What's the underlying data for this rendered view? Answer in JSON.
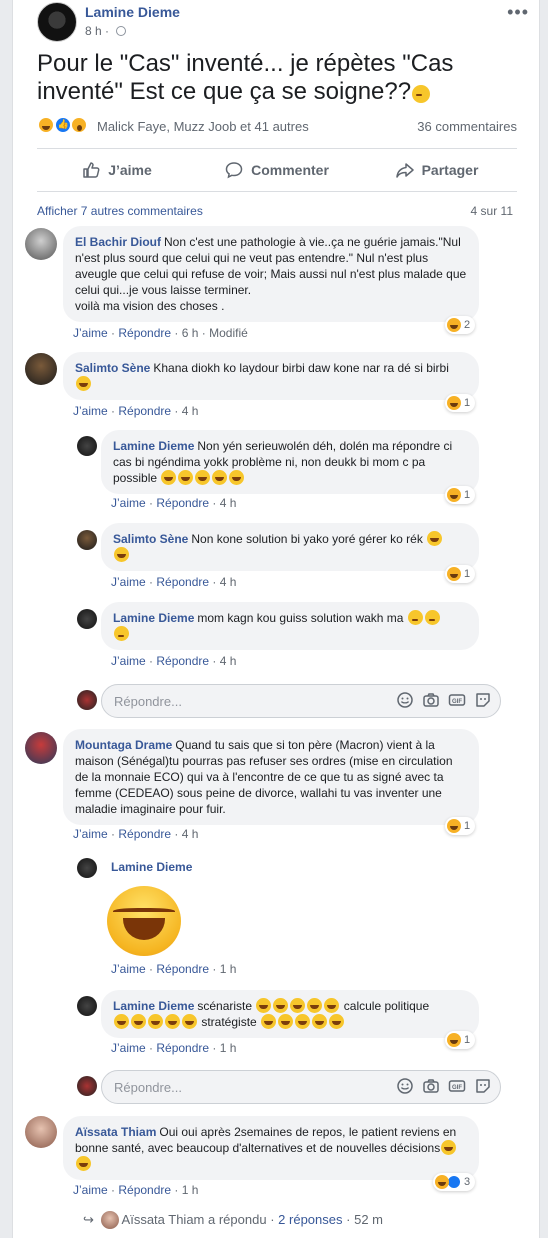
{
  "post": {
    "author": "Lamine Dieme",
    "time": "8 h",
    "text_part1": "Pour le \"Cas\" inventé... je répètes \"Cas inventé\" Est ce que ça se soigne??",
    "reactions_names": "Malick Faye, Muzz Joob et 41 autres",
    "comments_count": "36 commentaires",
    "actions": {
      "like": "J’aime",
      "comment": "Commenter",
      "share": "Partager"
    }
  },
  "comments_header": {
    "more": "Afficher 7 autres commentaires",
    "count": "4 sur 11"
  },
  "comments": [
    {
      "name": "El Bachir Diouf",
      "text": "Non c'est une pathologie à vie..ça ne guérie jamais.\"Nul n'est plus sourd que celui qui ne veut pas entendre.\" Nul n'est plus aveugle que celui qui refuse de voir; Mais aussi nul n'est plus malade que celui qui...je vous laisse terminer.",
      "text2": "voilà ma vision des choses .",
      "like": "J’aime",
      "reply": "Répondre",
      "time": "6 h",
      "edited": "Modifié",
      "reactions": "2"
    },
    {
      "name": "Salimto Sène",
      "text": "Khana diokh ko laydour birbi daw kone nar ra dé si birbi",
      "like": "J’aime",
      "reply": "Répondre",
      "time": "4 h",
      "reactions": "1",
      "replies": [
        {
          "name": "Lamine Dieme",
          "text": "Non yén serieuwolén déh, dolén ma répondre ci cas bi ngéndima yokk problème ni, non deukk bi mom c pa possible",
          "like": "J’aime",
          "reply": "Répondre",
          "time": "4 h",
          "reactions": "1"
        },
        {
          "name": "Salimto Sène",
          "text": "Non kone solution bi yako yoré gérer ko rék",
          "like": "J’aime",
          "reply": "Répondre",
          "time": "4 h",
          "reactions": "1"
        },
        {
          "name": "Lamine Dieme",
          "text": "mom kagn kou guiss solution wakh ma",
          "like": "J’aime",
          "reply": "Répondre",
          "time": "4 h"
        }
      ]
    },
    {
      "name": "Mountaga Drame",
      "text": "Quand tu sais que si ton père (Macron) vient à la maison (Sénégal)tu pourras pas refuser ses ordres (mise en circulation de la monnaie ECO) qui va à l'encontre de ce que tu as signé avec ta femme (CEDEAO) sous peine de divorce, wallahi tu vas inventer une maladie imaginaire pour fuir.",
      "like": "J’aime",
      "reply": "Répondre",
      "time": "4 h",
      "reactions": "1",
      "replies": [
        {
          "name": "Lamine Dieme",
          "like": "J’aime",
          "reply": "Répondre",
          "time": "1 h"
        },
        {
          "name": "Lamine Dieme",
          "text_a": "scénariste",
          "text_b": "calcule politique",
          "text_c": "stratégiste",
          "like": "J’aime",
          "reply": "Répondre",
          "time": "1 h",
          "reactions": "1"
        }
      ]
    },
    {
      "name": "Aïssata Thiam",
      "text": "Oui oui après 2semaines de repos, le patient reviens en bonne santé, avec beaucoup d'alternatives et de nouvelles décisions",
      "like": "J’aime",
      "reply": "Répondre",
      "time": "1 h",
      "reactions": "3",
      "replied": {
        "name": "Aïssata Thiam",
        "verb": "a répondu",
        "sep": "·",
        "count": "2 réponses",
        "time": "52 m"
      }
    }
  ],
  "reply_placeholder": "Répondre...",
  "sep": "·",
  "colors": {
    "link": "#385898",
    "bubble": "#f2f3f5",
    "haha": "#f7b125",
    "like": "#1877f2"
  }
}
